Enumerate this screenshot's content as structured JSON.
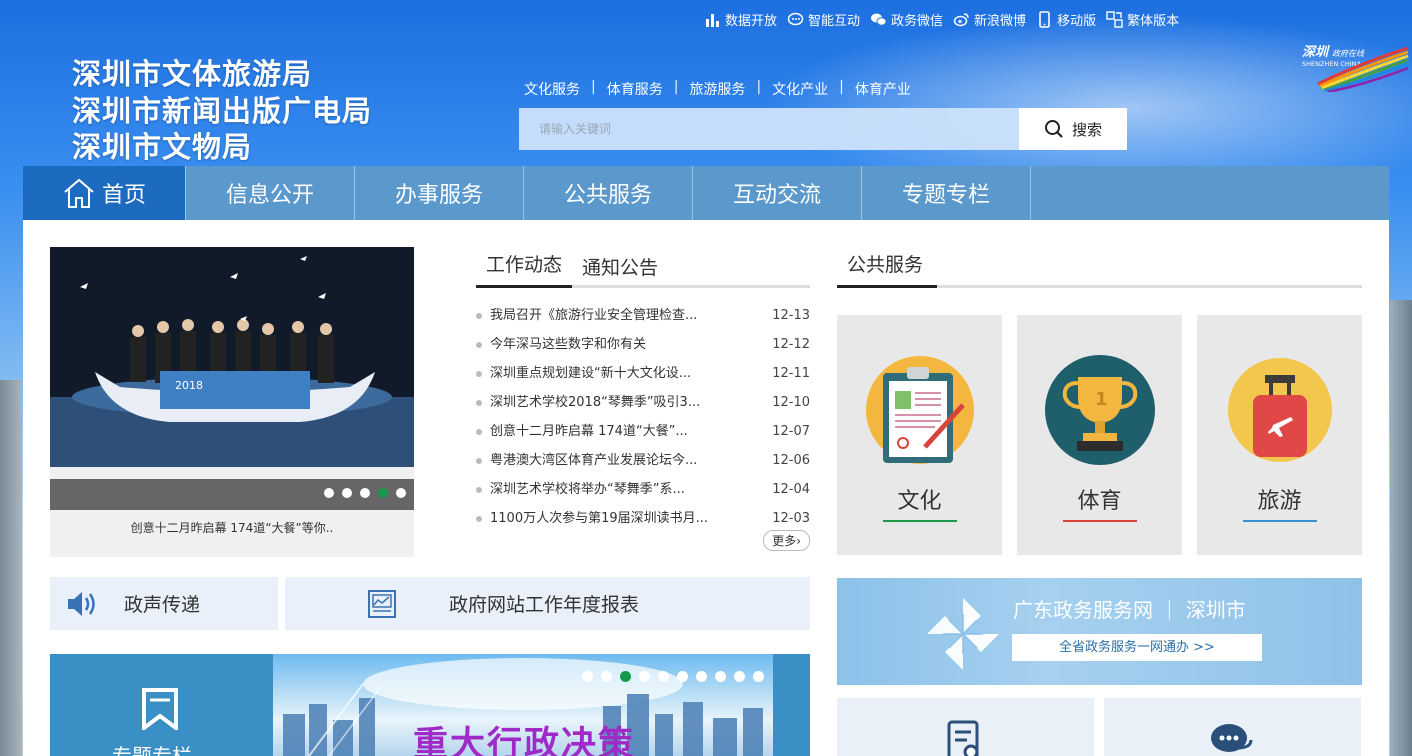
{
  "toplinks": [
    {
      "label": "数据开放",
      "icon": "bar-chart-icon"
    },
    {
      "label": "智能互动",
      "icon": "chat-bubble-icon"
    },
    {
      "label": "政务微信",
      "icon": "wechat-icon"
    },
    {
      "label": "新浪微博",
      "icon": "weibo-icon"
    },
    {
      "label": "移动版",
      "icon": "mobile-phone-icon"
    },
    {
      "label": "繁体版本",
      "icon": "traditional-chinese-icon"
    }
  ],
  "logo": {
    "line1": "深圳市文体旅游局",
    "line2": "深圳市新闻出版广电局",
    "line3": "深圳市文物局",
    "brand_small": "政府在线",
    "brand_en": "SHENZHEN CHINA"
  },
  "quicklinks": [
    "文化服务",
    "体育服务",
    "旅游服务",
    "文化产业",
    "体育产业"
  ],
  "quicklinks_sep": "|",
  "search": {
    "placeholder": "请输入关键词",
    "button": "搜索"
  },
  "nav": [
    "首页",
    "信息公开",
    "办事服务",
    "公共服务",
    "互动交流",
    "专题专栏"
  ],
  "slider": {
    "caption": "创意十二月昨启幕 174道“大餐”等你..",
    "active_dot": 4,
    "dot_count": 5
  },
  "news": {
    "tabs": [
      "工作动态",
      "通知公告"
    ],
    "items": [
      {
        "title": "我局召开《旅游行业安全管理检查...",
        "date": "12-13"
      },
      {
        "title": "今年深马这些数字和你有关",
        "date": "12-12"
      },
      {
        "title": "深圳重点规划建设“新十大文化设...",
        "date": "12-11"
      },
      {
        "title": "深圳艺术学校2018“琴舞季”吸引3...",
        "date": "12-10"
      },
      {
        "title": "创意十二月昨启幕 174道“大餐”...",
        "date": "12-07"
      },
      {
        "title": "粤港澳大湾区体育产业发展论坛今...",
        "date": "12-06"
      },
      {
        "title": "深圳艺术学校将举办“琴舞季”系...",
        "date": "12-04"
      },
      {
        "title": "1100万人次参与第19届深圳读书月...",
        "date": "12-03"
      }
    ],
    "more": "更多"
  },
  "public_service": {
    "title": "公共服务",
    "cards": [
      {
        "label": "文化",
        "underline": "#1f9a4a",
        "icon": "clipboard-icon"
      },
      {
        "label": "体育",
        "underline": "#d9443a",
        "icon": "trophy-icon"
      },
      {
        "label": "旅游",
        "underline": "#3a8fd0",
        "icon": "luggage-icon"
      }
    ]
  },
  "voice": {
    "label": "政声传递"
  },
  "report": {
    "label": "政府网站工作年度报表"
  },
  "gd_banner": {
    "title": "广东政务服务网 ｜ 深圳市",
    "subtitle": "全省政务服务一网通办 >>"
  },
  "zhuanti": {
    "label": "专题专栏",
    "banner_title": "重大行政决策",
    "dot_count": 10,
    "active_dot": 3
  },
  "colors": {
    "nav_bg": "#5b98cc",
    "nav_active": "#1c6bc0",
    "active_dot": "#159a4b"
  }
}
